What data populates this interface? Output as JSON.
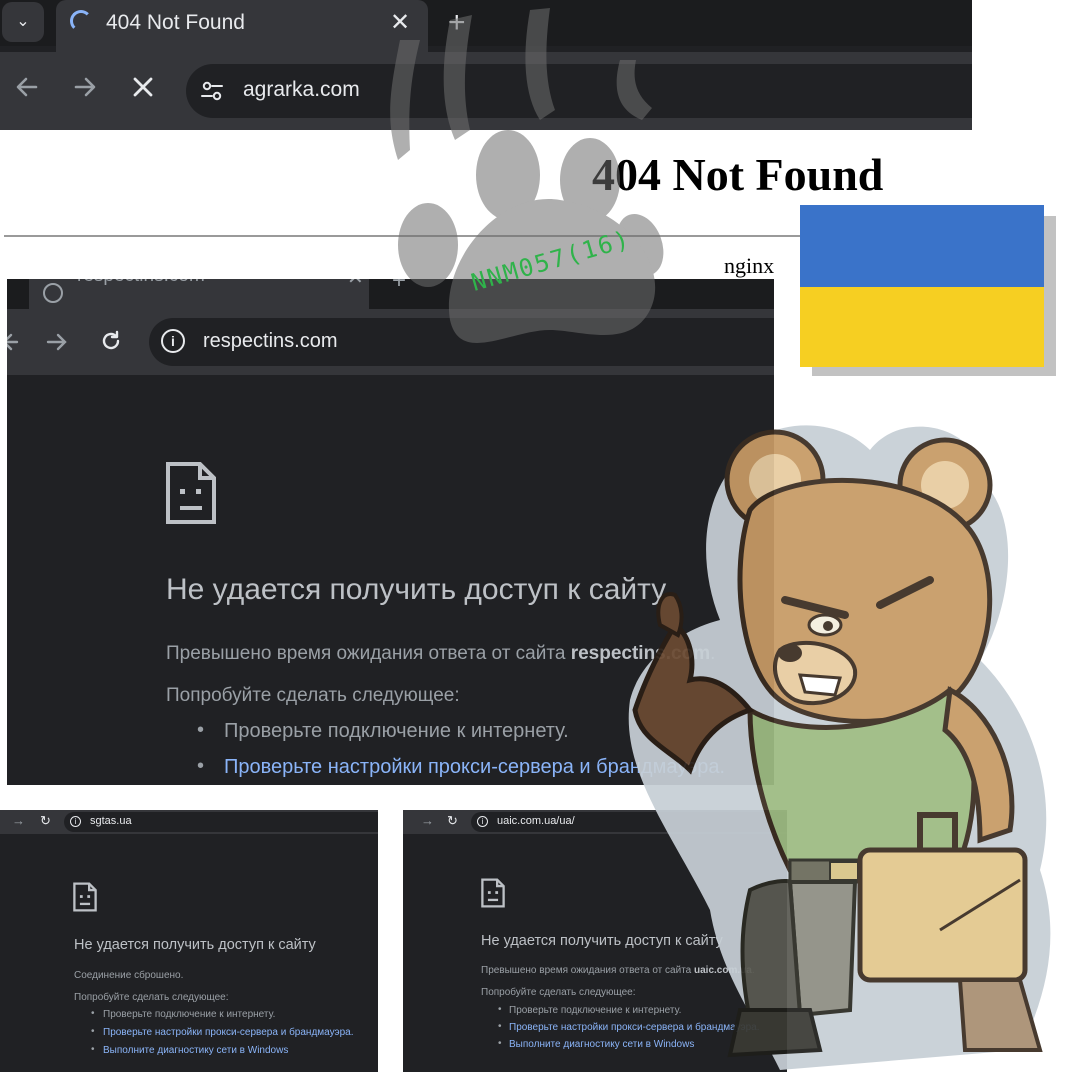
{
  "top_browser": {
    "tab_title": "404 Not Found",
    "tab_close": "✕",
    "new_tab": "+",
    "url": "agrarka.com"
  },
  "nginx_page": {
    "title": "404 Not Found",
    "server": "nginx"
  },
  "watermark": {
    "text": "NNM057(16)"
  },
  "window_main": {
    "tab_title": "respectins.com",
    "tab_close": "✕",
    "new_tab": "+",
    "url": "respectins.com",
    "error_title": "Не удается получить доступ к сайту",
    "error_message_prefix": "Превышено время ожидания ответа от сайта ",
    "error_message_site": "respectins.com",
    "try_heading": "Попробуйте сделать следующее:",
    "suggestions": [
      "Проверьте подключение к интернету.",
      "Проверьте настройки прокси-сервера и брандмауэра."
    ]
  },
  "window_sgtas": {
    "url": "sgtas.ua",
    "error_title": "Не удается получить доступ к сайту",
    "error_message": "Соединение сброшено.",
    "try_heading": "Попробуйте сделать следующее:",
    "suggestions": [
      "Проверьте подключение к интернету.",
      "Проверьте настройки прокси-сервера и брандмауэра.",
      "Выполните диагностику сети в Windows"
    ]
  },
  "window_uaic": {
    "url": "uaic.com.ua/ua/",
    "error_title": "Не удается получить доступ к сайту",
    "error_message_prefix": "Превышено время ожидания ответа от сайта ",
    "error_message_site": "uaic.com.ua",
    "try_heading": "Попробуйте сделать следующее:",
    "suggestions": [
      "Проверьте подключение к интернету.",
      "Проверьте настройки прокси-сервера и брандмауэра.",
      "Выполните диагностику сети в Windows"
    ]
  },
  "colors": {
    "chrome_dark": "#202124",
    "chrome_toolbar": "#35363a",
    "link_blue": "#8ab4f8",
    "flag_blue": "#3a73c9",
    "flag_yellow": "#f6cf22",
    "watermark_green": "#2fb34a"
  }
}
